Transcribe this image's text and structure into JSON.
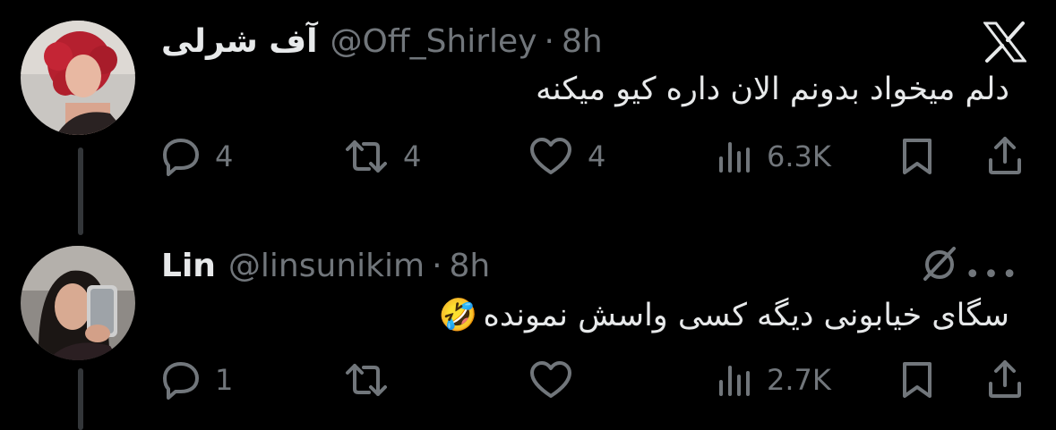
{
  "tweet1": {
    "display_name": "آف شرلی",
    "handle": "@Off_Shirley",
    "separator": "·",
    "time": "8h",
    "text": "دلم میخواد بدونم الان داره کیو میکنه",
    "replies": "4",
    "reposts": "4",
    "likes": "4",
    "views": "6.3K"
  },
  "tweet2": {
    "display_name": "Lin",
    "handle": "@linsunikim",
    "separator": "·",
    "time": "8h",
    "text": "سگای خیابونی دیگه کسی واسش نمونده",
    "emoji": "🤣",
    "replies": "1",
    "views": "2.7K",
    "more": "•••"
  },
  "icons": [
    "x-logo-icon",
    "reply-icon",
    "repost-icon",
    "like-icon",
    "views-icon",
    "bookmark-icon",
    "share-icon",
    "grok-icon",
    "more-icon"
  ],
  "colors": {
    "background": "#000000",
    "text": "#e7e9ea",
    "muted": "#71767b",
    "thread_line": "#333639"
  }
}
